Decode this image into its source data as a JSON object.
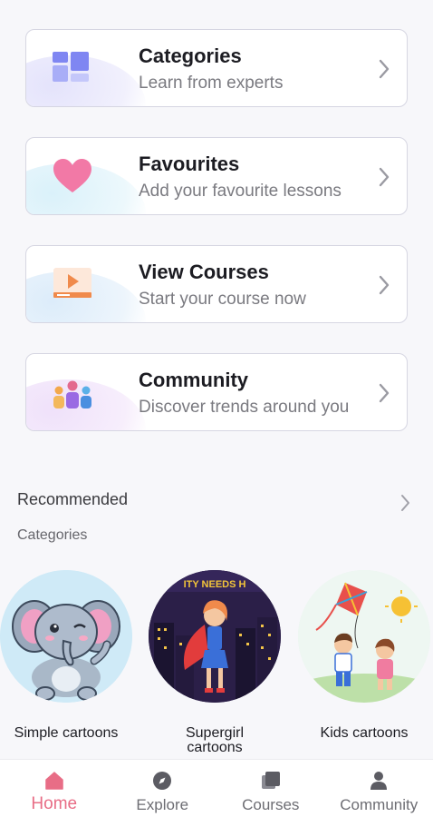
{
  "menu_cards": [
    {
      "title": "Categories",
      "subtitle": "Learn from experts",
      "icon": "grid-icon",
      "blob_color": "#ebeafb"
    },
    {
      "title": "Favourites",
      "subtitle": "Add your favourite lessons",
      "icon": "heart-icon",
      "blob_color": "#e3f5fb"
    },
    {
      "title": "View Courses",
      "subtitle": "Start your course now",
      "icon": "video-icon",
      "blob_color": "#e6f1fb"
    },
    {
      "title": "Community",
      "subtitle": "Discover trends around you",
      "icon": "people-icon",
      "blob_color": "#f3e8fb"
    }
  ],
  "recommended": {
    "title": "Recommended",
    "subtitle": "Categories"
  },
  "categories": [
    {
      "label": "Simple cartoons"
    },
    {
      "label": "Supergirl\ncartoons"
    },
    {
      "label": "Kids cartoons"
    }
  ],
  "bottom_nav": [
    {
      "label": "Home",
      "icon": "home-icon",
      "active": true
    },
    {
      "label": "Explore",
      "icon": "compass-icon",
      "active": false
    },
    {
      "label": "Courses",
      "icon": "courses-icon",
      "active": false
    },
    {
      "label": "Community",
      "icon": "person-icon",
      "active": false
    }
  ],
  "colors": {
    "accent": "#e86d86",
    "grid_icon": "#7f86f2",
    "heart_icon": "#f279a6",
    "video_icon": "#f08a4b"
  }
}
